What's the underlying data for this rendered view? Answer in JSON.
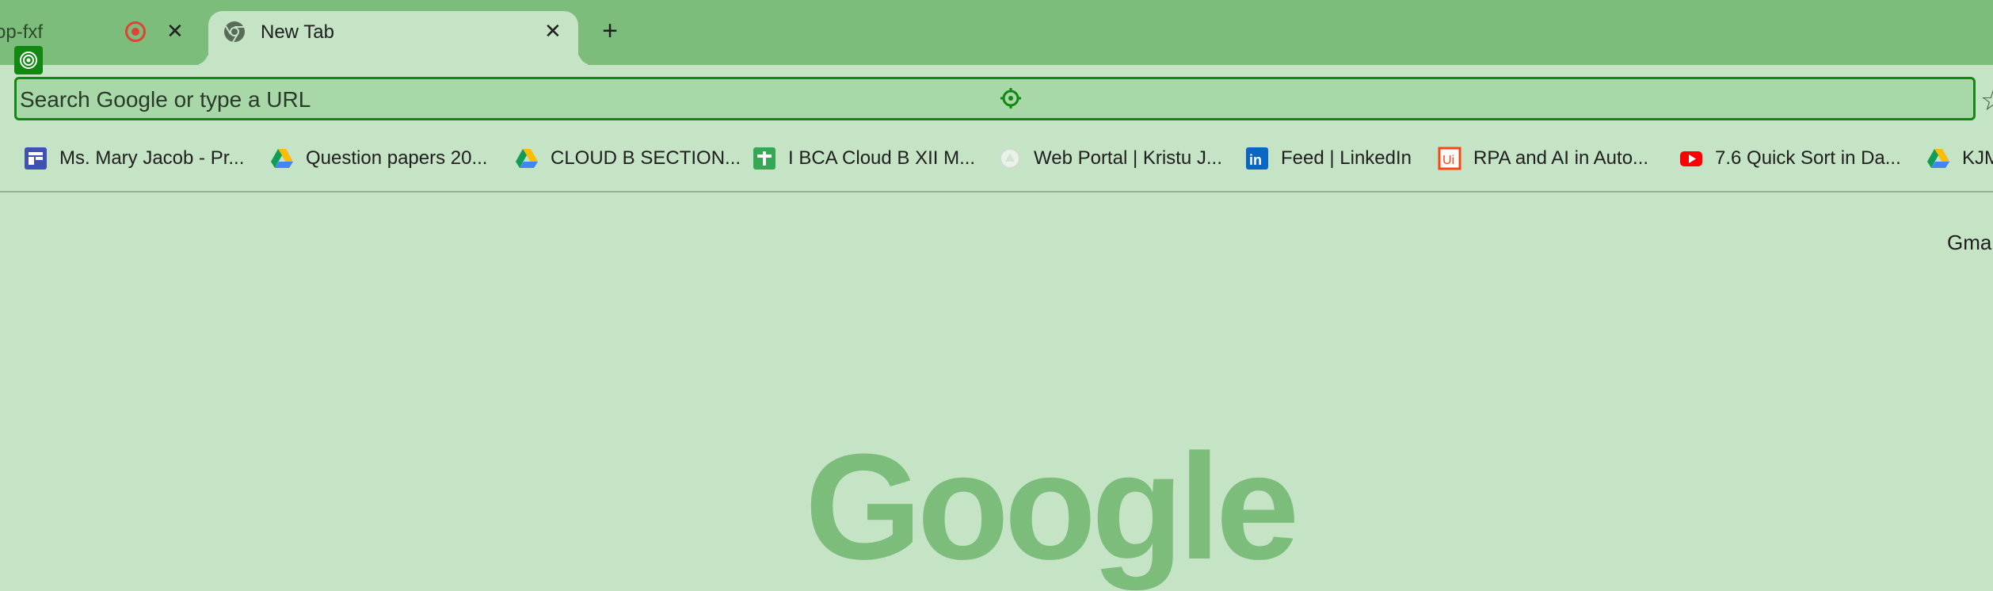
{
  "tabs": [
    {
      "title": "op-fxf",
      "recording_icon": "record-icon",
      "close_label": "✕"
    },
    {
      "title": "New Tab",
      "icon": "chrome-icon",
      "close_label": "✕"
    }
  ],
  "new_tab_label": "+",
  "omnibox": {
    "placeholder": "Search Google or type a URL"
  },
  "bookmarks": [
    {
      "label": "Ms. Mary Jacob - Pr...",
      "icon": "google-classroom-icon"
    },
    {
      "label": "Question papers 20...",
      "icon": "google-drive-icon"
    },
    {
      "label": "CLOUD B SECTION...",
      "icon": "google-drive-icon"
    },
    {
      "label": "I BCA Cloud B XII M...",
      "icon": "google-sheets-icon"
    },
    {
      "label": "Web Portal | Kristu J...",
      "icon": "web-portal-icon"
    },
    {
      "label": "Feed | LinkedIn",
      "icon": "linkedin-icon"
    },
    {
      "label": "RPA and AI in Auto...",
      "icon": "uipath-icon"
    },
    {
      "label": "7.6 Quick Sort in Da...",
      "icon": "youtube-icon"
    },
    {
      "label": "KJM",
      "icon": "google-drive-icon"
    }
  ],
  "content": {
    "gmail_link": "Gmail",
    "logo_text": "Google"
  },
  "colors": {
    "tab_strip": "#7cbd7c",
    "background": "#c5e3c5",
    "omnibox": "#a8d8a8",
    "accent": "#118811"
  }
}
